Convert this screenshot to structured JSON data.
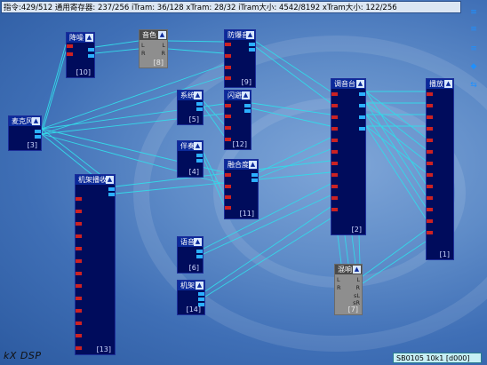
{
  "topbar": "指令:429/512 通用寄存器: 237/256 iTram: 36/128 xTram: 28/32 iTram大小: 4542/8192 xTram大小: 122/256",
  "modules": [
    {
      "key": "mic",
      "title": "麦克风",
      "label": "[3]"
    },
    {
      "key": "noise",
      "title": "降噪",
      "label": "[10]"
    },
    {
      "key": "tone",
      "title": "音色",
      "label": "[8]",
      "ports": [
        "L",
        "L",
        "R",
        "R"
      ]
    },
    {
      "key": "clip",
      "title": "防爆音",
      "label": "[9]"
    },
    {
      "key": "system",
      "title": "系统",
      "label": "[5]"
    },
    {
      "key": "flash",
      "title": "闪避",
      "label": "[12]"
    },
    {
      "key": "accomp",
      "title": "伴奏",
      "label": "[4]"
    },
    {
      "key": "blend",
      "title": "融合度",
      "label": "[11]"
    },
    {
      "key": "rack",
      "title": "机架播收",
      "label": "[13]"
    },
    {
      "key": "voice",
      "title": "语音",
      "label": "[6]"
    },
    {
      "key": "machine",
      "title": "机架",
      "label": "[14]"
    },
    {
      "key": "mixer",
      "title": "调音台",
      "label": "[2]"
    },
    {
      "key": "play",
      "title": "播放",
      "label": "[1]"
    },
    {
      "key": "reverb",
      "title": "混响",
      "label": "[7]",
      "ports": [
        "L",
        "L",
        "R",
        "R",
        "sL",
        "sR"
      ]
    }
  ],
  "footer_logo": "kX DSP",
  "status": "SB0105 10k1 [d000]",
  "icons": {
    "collapse": "collapse-arrow-icon"
  }
}
